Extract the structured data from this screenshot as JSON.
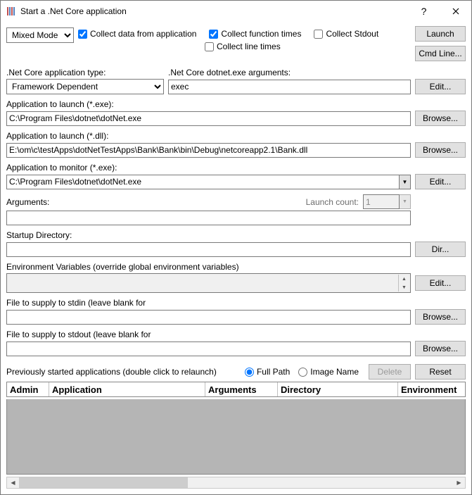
{
  "window": {
    "title": "Start a .Net Core application"
  },
  "topbar": {
    "mode_options": [
      "Mixed Mode"
    ],
    "mode_selected": "Mixed Mode",
    "chk_collect_data": "Collect data from application",
    "chk_collect_func_times": "Collect function times",
    "chk_collect_stdout": "Collect Stdout",
    "chk_collect_line_times": "Collect line times",
    "btn_launch": "Launch",
    "btn_cmdline": "Cmd Line..."
  },
  "appType": {
    "label": ".Net Core application type:",
    "selected": "Framework Dependent",
    "args_label": ".Net Core dotnet.exe arguments:",
    "args_value": "exec",
    "btn_edit": "Edit..."
  },
  "launchExe": {
    "label": "Application to launch (*.exe):",
    "value": "C:\\Program Files\\dotnet\\dotNet.exe",
    "btn": "Browse..."
  },
  "launchDll": {
    "label": "Application to launch (*.dll):",
    "value": "E:\\om\\c\\testApps\\dotNetTestApps\\Bank\\Bank\\bin\\Debug\\netcoreapp2.1\\Bank.dll",
    "btn": "Browse..."
  },
  "monitorExe": {
    "label": "Application to monitor (*.exe):",
    "value": "C:\\Program Files\\dotnet\\dotNet.exe",
    "btn": "Edit..."
  },
  "arguments": {
    "label": "Arguments:",
    "value": "",
    "launch_count_label": "Launch count:",
    "launch_count_value": "1"
  },
  "startupDir": {
    "label": "Startup Directory:",
    "value": "",
    "btn": "Dir..."
  },
  "envVars": {
    "label": "Environment Variables (override global environment variables)",
    "btn": "Edit..."
  },
  "stdin": {
    "label": "File to supply to stdin (leave blank for",
    "value": "",
    "btn": "Browse..."
  },
  "stdout": {
    "label": "File to supply to stdout (leave blank for",
    "value": "",
    "btn": "Browse..."
  },
  "history": {
    "label": "Previously started applications (double click to relaunch)",
    "radio_fullpath": "Full Path",
    "radio_imagename": "Image Name",
    "btn_delete": "Delete",
    "btn_reset": "Reset",
    "columns": {
      "admin": "Admin",
      "application": "Application",
      "arguments": "Arguments",
      "directory": "Directory",
      "environment": "Environment"
    }
  }
}
